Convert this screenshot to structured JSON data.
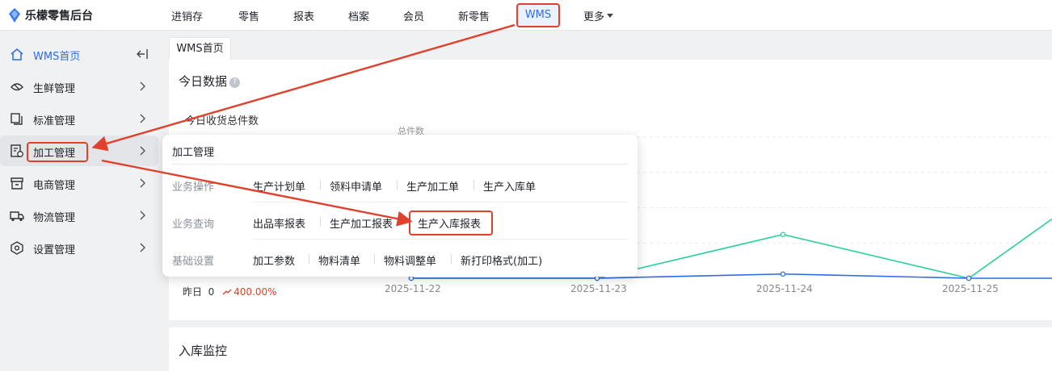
{
  "brand": {
    "name": "乐檬零售后台"
  },
  "topnav": {
    "items": [
      "进销存",
      "零售",
      "报表",
      "档案",
      "会员",
      "新零售"
    ],
    "active": "WMS",
    "more": "更多"
  },
  "sidebar": {
    "items": [
      {
        "label": "WMS首页",
        "icon": "home-icon"
      },
      {
        "label": "生鲜管理",
        "icon": "fresh-icon"
      },
      {
        "label": "标准管理",
        "icon": "copy-icon"
      },
      {
        "label": "加工管理",
        "icon": "process-doc-icon"
      },
      {
        "label": "电商管理",
        "icon": "store-icon"
      },
      {
        "label": "物流管理",
        "icon": "truck-icon"
      },
      {
        "label": "设置管理",
        "icon": "settings-icon"
      }
    ],
    "collapse_icon": "collapse-icon"
  },
  "tabs": [
    "WMS首页"
  ],
  "dashboard": {
    "section_title": "今日数据",
    "metric_label": "今日收货总件数",
    "yesterday_label": "昨日",
    "yesterday_value": "0",
    "change_pct": "400.00%"
  },
  "chart_data": {
    "type": "line",
    "ylabel": "总件数",
    "x": [
      "2025-11-22",
      "2025-11-23",
      "2025-11-24",
      "2025-11-25"
    ],
    "series": [
      {
        "color": "#2bd19a",
        "values": [
          0,
          0,
          31,
          0
        ]
      },
      {
        "color": "#2e6be6",
        "values": [
          0,
          0,
          3,
          0
        ]
      }
    ]
  },
  "section2": {
    "title": "入库监控"
  },
  "popup": {
    "title": "加工管理",
    "groups": [
      {
        "label": "业务操作",
        "links": [
          "生产计划单",
          "领料申请单",
          "生产加工单",
          "生产入库单"
        ]
      },
      {
        "label": "业务查询",
        "links": [
          "出品率报表",
          "生产加工报表",
          "生产入库报表"
        ]
      },
      {
        "label": "基础设置",
        "links": [
          "加工参数",
          "物料清单",
          "物料调整单",
          "新打印格式(加工)"
        ]
      }
    ]
  },
  "colors": {
    "accent": "#2e6be6",
    "annotation": "#e0402c"
  }
}
